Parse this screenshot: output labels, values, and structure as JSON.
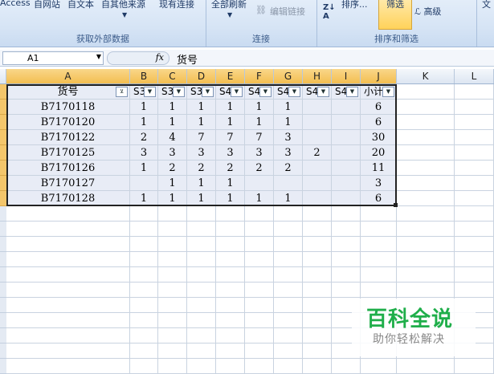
{
  "ribbon": {
    "access": "Access",
    "from_web": "自网站",
    "from_text": "自文本",
    "from_other": "自其他来源",
    "existing": "现有连接",
    "refresh_all": "全部刷新",
    "edit_links": "编辑链接",
    "sort": "排序...",
    "filter": "筛选",
    "advanced": "高级",
    "group_external": "获取外部数据",
    "group_connections": "连接",
    "group_sort_filter": "排序和筛选"
  },
  "formula_bar": {
    "name_box": "A1",
    "fx": "fx",
    "content": "货号"
  },
  "columns": [
    "A",
    "B",
    "C",
    "D",
    "E",
    "F",
    "G",
    "H",
    "I",
    "J",
    "K",
    "L"
  ],
  "table": {
    "headers": [
      "货号",
      "S3",
      "S3",
      "S3",
      "S4",
      "S4",
      "S4",
      "S4",
      "S4",
      "小计"
    ],
    "rows": [
      [
        "B7170118",
        "1",
        "1",
        "1",
        "1",
        "1",
        "1",
        "",
        "",
        "6"
      ],
      [
        "B7170120",
        "1",
        "1",
        "1",
        "1",
        "1",
        "1",
        "",
        "",
        "6"
      ],
      [
        "B7170122",
        "2",
        "4",
        "7",
        "7",
        "7",
        "3",
        "",
        "",
        "30"
      ],
      [
        "B7170125",
        "3",
        "3",
        "3",
        "3",
        "3",
        "3",
        "2",
        "",
        "20"
      ],
      [
        "B7170126",
        "1",
        "2",
        "2",
        "2",
        "2",
        "2",
        "",
        "",
        "11"
      ],
      [
        "B7170127",
        "",
        "1",
        "1",
        "1",
        "",
        "",
        "",
        "",
        "3"
      ],
      [
        "B7170128",
        "1",
        "1",
        "1",
        "1",
        "1",
        "1",
        "",
        "",
        "6"
      ]
    ]
  },
  "watermark": {
    "title": "百科全说",
    "subtitle": "助你轻松解决"
  }
}
